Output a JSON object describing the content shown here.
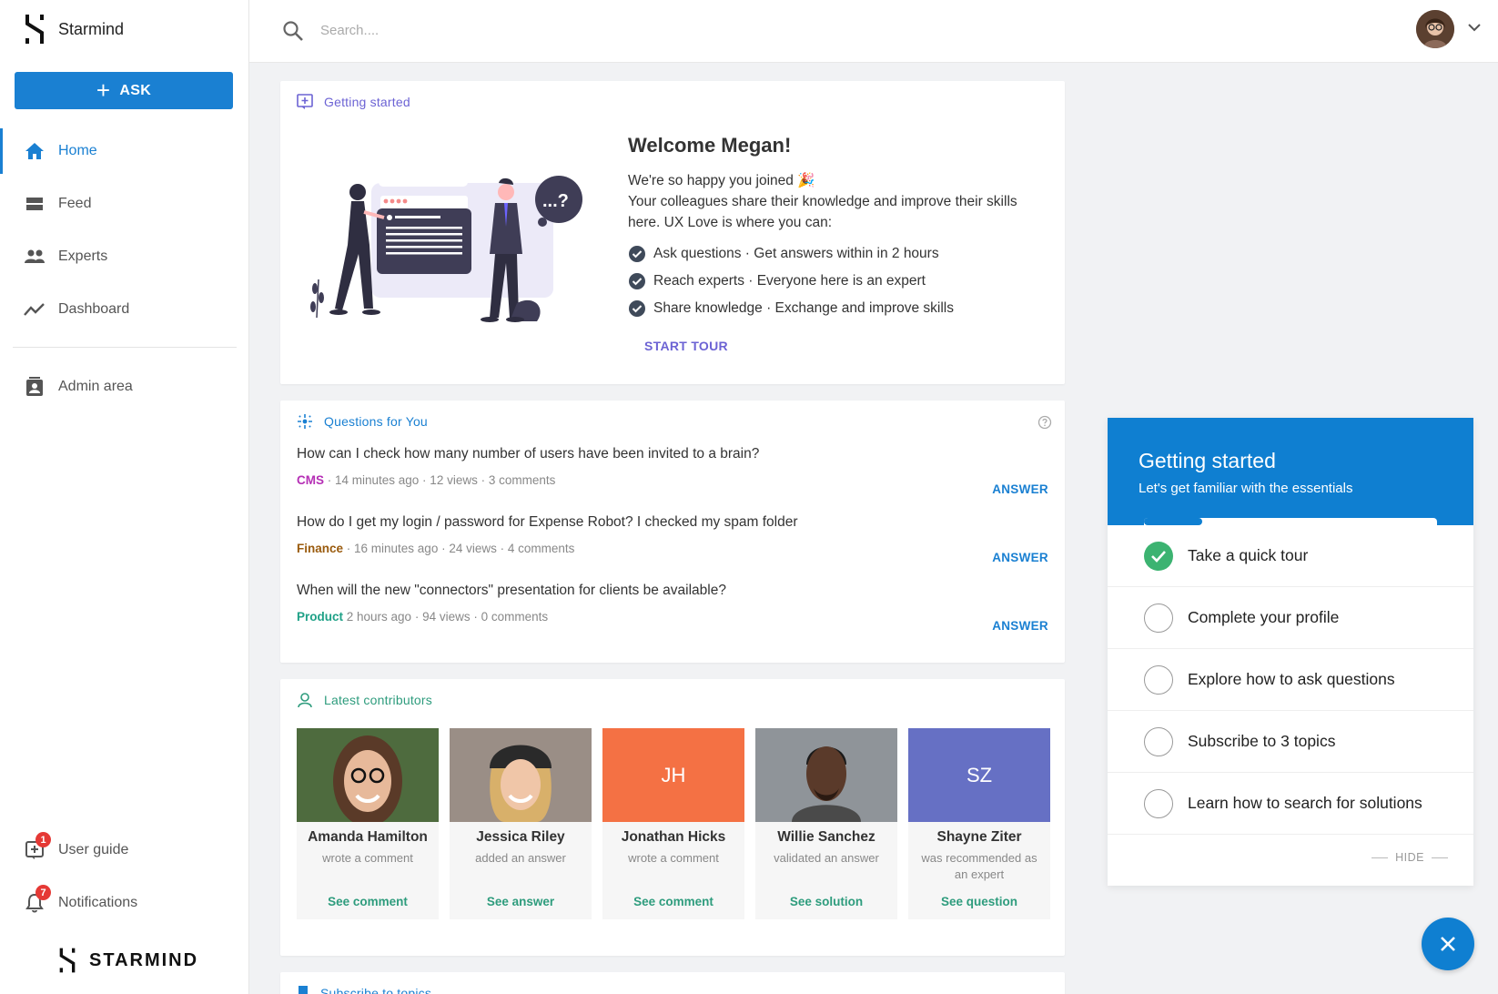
{
  "app": {
    "name": "Starmind",
    "footer_brand": "STARMIND"
  },
  "sidebar": {
    "ask_label": "ASK",
    "items": [
      {
        "label": "Home",
        "icon": "home-icon",
        "active": true
      },
      {
        "label": "Feed",
        "icon": "feed-icon"
      },
      {
        "label": "Experts",
        "icon": "experts-icon"
      },
      {
        "label": "Dashboard",
        "icon": "dashboard-icon"
      }
    ],
    "admin_label": "Admin area",
    "user_guide": {
      "label": "User guide",
      "badge": "1"
    },
    "notifications": {
      "label": "Notifications",
      "badge": "7"
    }
  },
  "search": {
    "placeholder": "Search...."
  },
  "getting_started_card": {
    "header": "Getting started",
    "title": "Welcome Megan!",
    "intro_line": "We're so happy you joined 🎉",
    "body": "Your colleagues share their knowledge and improve their skills here. UX Love is where you can:",
    "checks": [
      "Ask questions · Get answers within in 2 hours",
      "Reach experts · Everyone here is an expert",
      "Share knowledge · Exchange and improve skills"
    ],
    "cta": "START TOUR",
    "illustration_bubble": "...?"
  },
  "questions_card": {
    "header": "Questions for You",
    "answer_label": "ANSWER",
    "items": [
      {
        "title": "How can I check how many number of users have been invited to a brain?",
        "topic": "CMS",
        "topic_color": "#b52fb5",
        "meta": " · 14 minutes ago · 12 views · 3 comments"
      },
      {
        "title": "How do I get my login / password for Expense Robot? I checked my spam folder",
        "topic": "Finance",
        "topic_color": "#9a5b0e",
        "meta": " · 16 minutes ago · 24 views · 4 comments"
      },
      {
        "title": "When will the new \"connectors\" presentation for clients be available?",
        "topic": "Product",
        "topic_color": "#1fa187",
        "meta": " 2 hours ago · 94 views · 0 comments"
      }
    ]
  },
  "contributors_card": {
    "header": "Latest contributors",
    "items": [
      {
        "name": "Amanda Hamilton",
        "action": "wrote a comment",
        "link": "See comment",
        "initials": "",
        "color": "#7a5a48"
      },
      {
        "name": "Jessica Riley",
        "action": "added an answer",
        "link": "See answer",
        "initials": "",
        "color": "#8b6f5c"
      },
      {
        "name": "Jonathan Hicks",
        "action": "wrote a comment",
        "link": "See comment",
        "initials": "JH",
        "color": "#f47144"
      },
      {
        "name": "Willie Sanchez",
        "action": "validated an answer",
        "link": "See solution",
        "initials": "",
        "color": "#6b6b6b"
      },
      {
        "name": "Shayne Ziter",
        "action": "was recommended as an expert",
        "link": "See question",
        "initials": "SZ",
        "color": "#6670c4"
      }
    ]
  },
  "subscribe_card": {
    "header": "Subscribe to topics"
  },
  "onboarding_panel": {
    "title": "Getting started",
    "subtitle": "Let's get familiar with the essentials",
    "progress": 0.2,
    "steps": [
      {
        "label": "Take a quick tour",
        "done": true
      },
      {
        "label": "Complete your profile",
        "done": false
      },
      {
        "label": "Explore how to ask questions",
        "done": false
      },
      {
        "label": "Subscribe to 3 topics",
        "done": false
      },
      {
        "label": "Learn how to search for solutions",
        "done": false
      }
    ],
    "hide_label": "HIDE"
  },
  "colors": {
    "primary": "#1a80d2",
    "purple": "#6c63d4",
    "green": "#2e9c7d",
    "check_done": "#3cb371"
  }
}
